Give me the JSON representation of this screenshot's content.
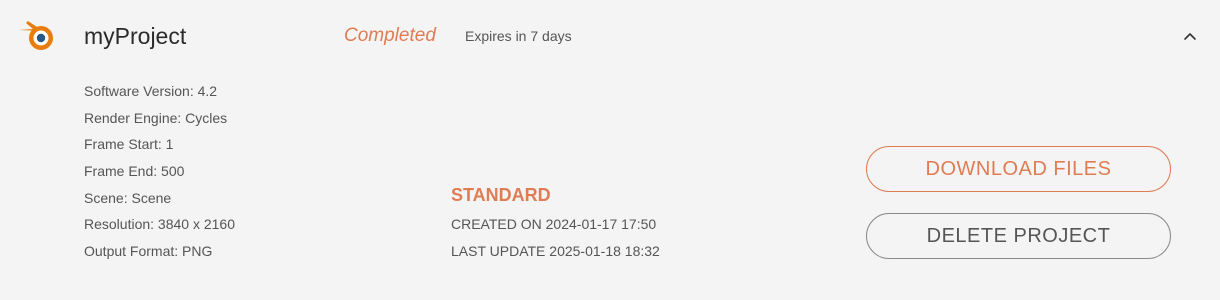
{
  "project": {
    "name": "myProject",
    "status": "Completed",
    "expires": "Expires in 7 days"
  },
  "details": [
    "Software Version: 4.2",
    "Render Engine: Cycles",
    "Frame Start: 1",
    "Frame End: 500",
    "Scene: Scene",
    "Resolution: 3840 x 2160",
    "Output Format: PNG"
  ],
  "plan": {
    "name": "STANDARD",
    "created": "CREATED ON 2024-01-17 17:50",
    "updated": "LAST UPDATE 2025-01-18 18:32"
  },
  "actions": {
    "download_label": "DOWNLOAD FILES",
    "delete_label": "DELETE PROJECT"
  },
  "icons": {
    "logo": "blender-logo-icon",
    "toggle": "chevron-up-icon"
  },
  "colors": {
    "accent": "#e07c52",
    "text": "#555555",
    "background": "#f4f4f4",
    "logo_blue": "#265787"
  }
}
